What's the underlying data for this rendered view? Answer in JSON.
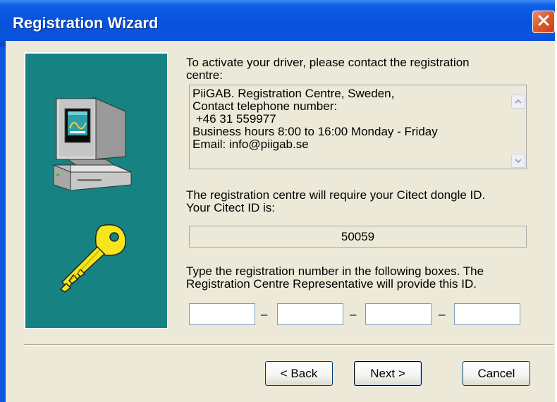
{
  "window": {
    "title": "Registration Wizard"
  },
  "instructions": {
    "line1": "To activate your driver, please contact the registration",
    "line2": "centre:"
  },
  "contact_box": {
    "lines": [
      "PiiGAB. Registration Centre, Sweden,",
      "Contact telephone number:",
      " +46 31 559977",
      "Business hours 8:00 to 16:00 Monday - Friday",
      "Email: info@piigab.se"
    ]
  },
  "dongle": {
    "line1": "The registration centre will require your Citect dongle ID.",
    "line2": "Your Citect ID is:",
    "citect_id": "50059"
  },
  "registration": {
    "line1": "Type the registration number in the following boxes. The",
    "line2": "Registration Centre Representative will provide this ID.",
    "fields": [
      "",
      "",
      "",
      ""
    ],
    "separator": "–"
  },
  "buttons": {
    "back": "< Back",
    "next": "Next >",
    "cancel": "Cancel"
  },
  "icons": {
    "close": "close-icon",
    "computer": "computer-icon",
    "key": "key-icon",
    "scroll_up": "scroll-up-icon",
    "scroll_down": "scroll-down-icon"
  },
  "colors": {
    "titlebar": "#0a54dd",
    "side_panel": "#168282",
    "dialog": "#ece9d8",
    "close_button": "#e05a2c"
  }
}
